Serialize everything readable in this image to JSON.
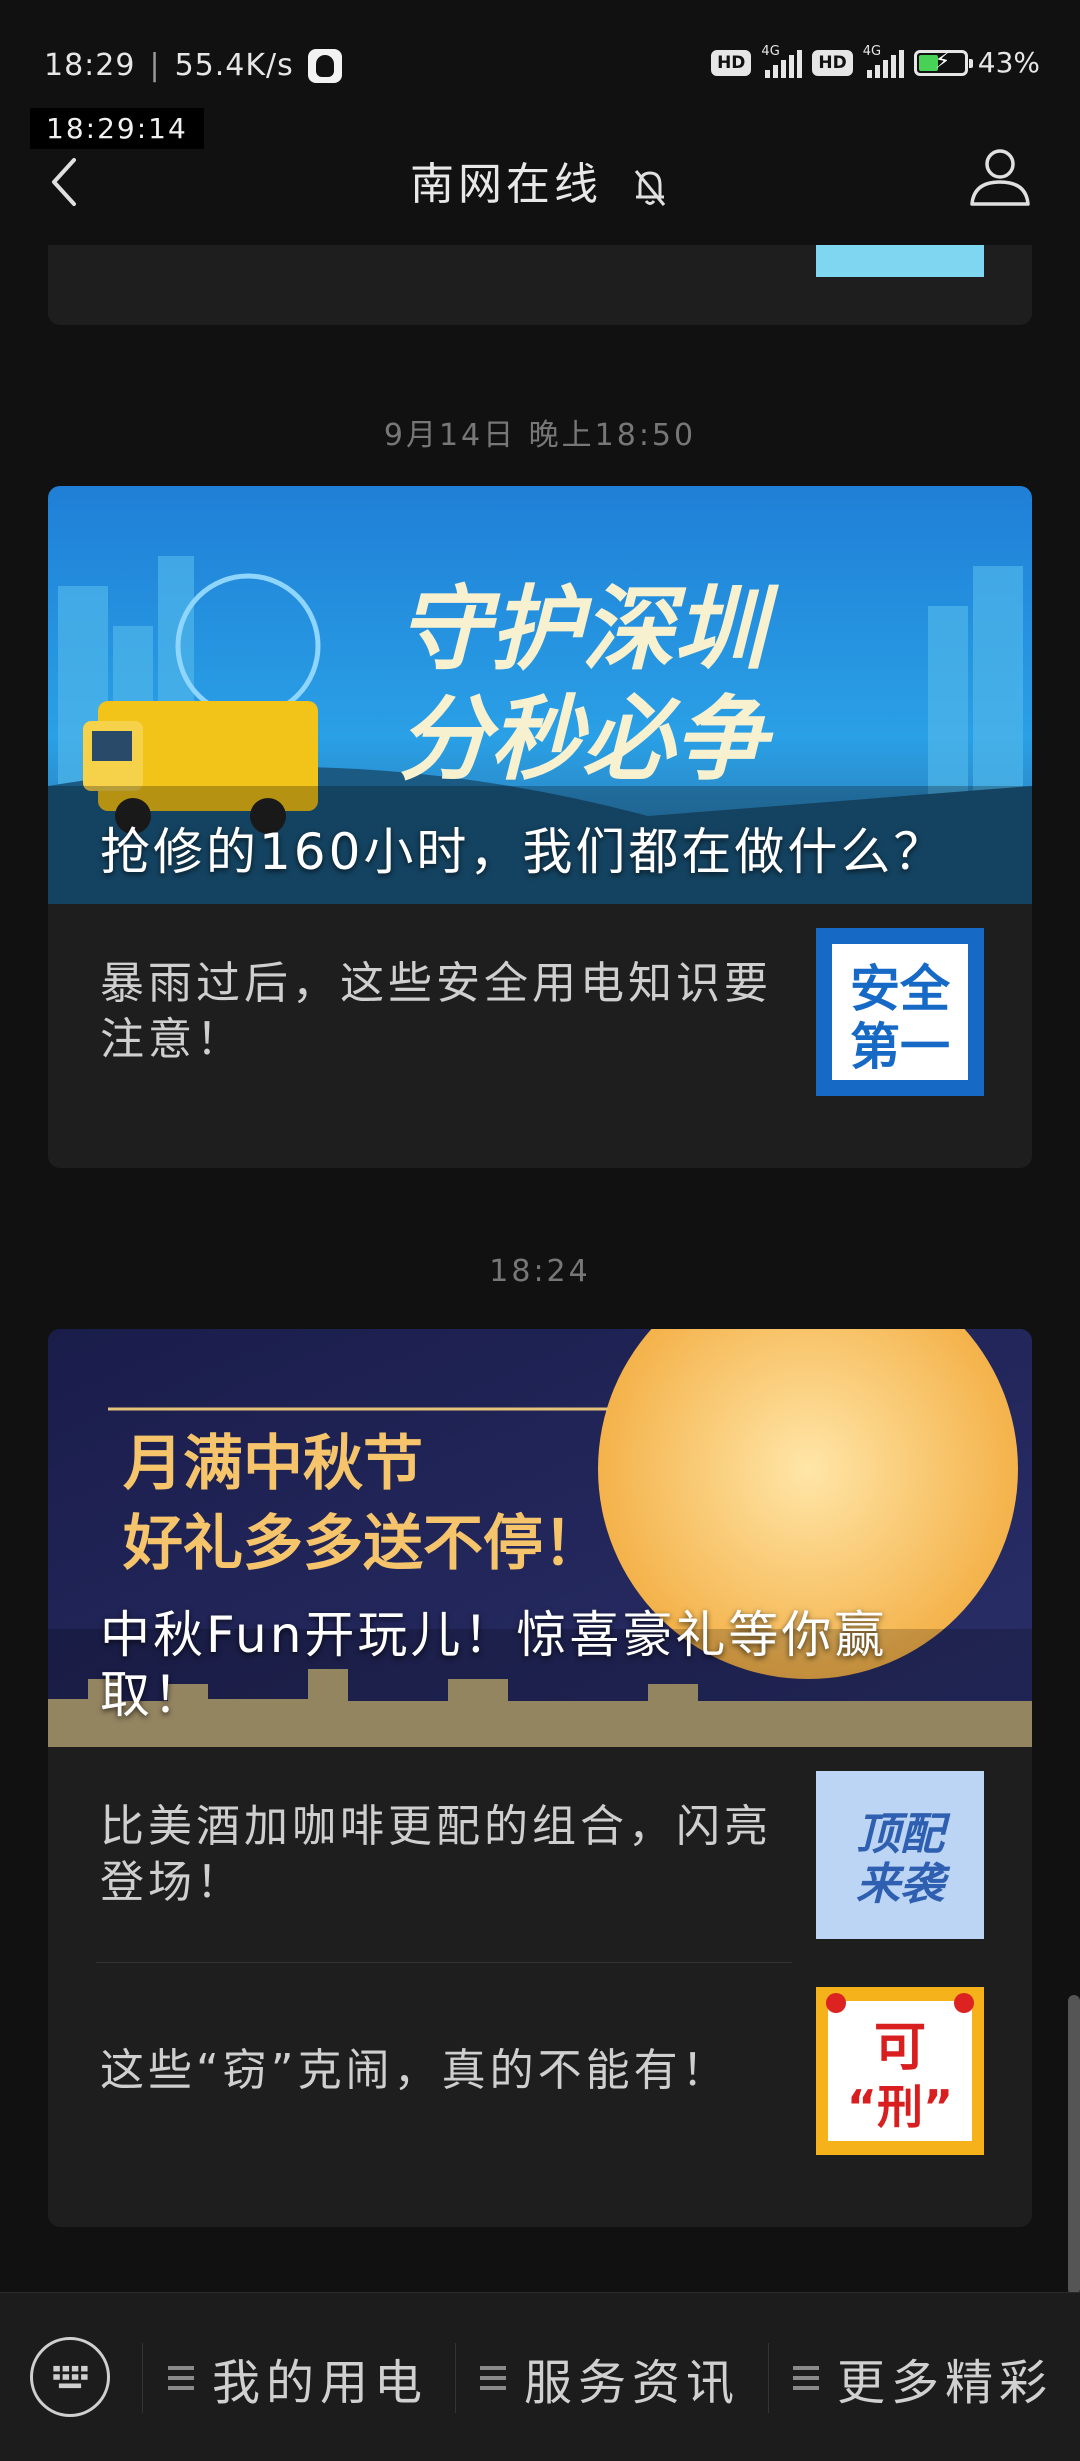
{
  "status_bar": {
    "time": "18:29",
    "net_speed": "55.4K/s",
    "sim1_label": "HD",
    "sim1_gen": "4G",
    "sim2_label": "HD",
    "sim2_gen": "4G",
    "battery_level_percent": 43,
    "battery_text": "43%"
  },
  "clock_overlay": "18:29:14",
  "header": {
    "title": "南网在线"
  },
  "messages": [
    {
      "time": "9月14日 晚上18:50",
      "banner_title": "抢修的160小时，我们都在做什么？",
      "banner_art_text_1": "守护深圳",
      "banner_art_text_2": "分秒必争",
      "items": [
        {
          "text": "暴雨过后，这些安全用电知识要注意！",
          "thumb_line1": "安全",
          "thumb_line2": "第一"
        }
      ]
    },
    {
      "time": "18:24",
      "banner_title": "中秋Fun开玩儿！惊喜豪礼等你赢取！",
      "banner_art_text_1": "月满中秋节",
      "banner_art_text_2": "好礼多多送不停！",
      "items": [
        {
          "text": "比美酒加咖啡更配的组合，闪亮登场！",
          "thumb_line1": "顶配",
          "thumb_line2": "来袭"
        },
        {
          "text": "这些“窃”克闹，真的不能有！",
          "thumb_line1": "可",
          "thumb_line2": "“刑”"
        }
      ]
    }
  ],
  "bottom_nav": {
    "items": [
      "我的用电",
      "服务资讯",
      "更多精彩"
    ]
  },
  "colors": {
    "background": "#111111",
    "card": "#1e1e1e",
    "timestamp": "#777777",
    "battery": "#47d156"
  }
}
